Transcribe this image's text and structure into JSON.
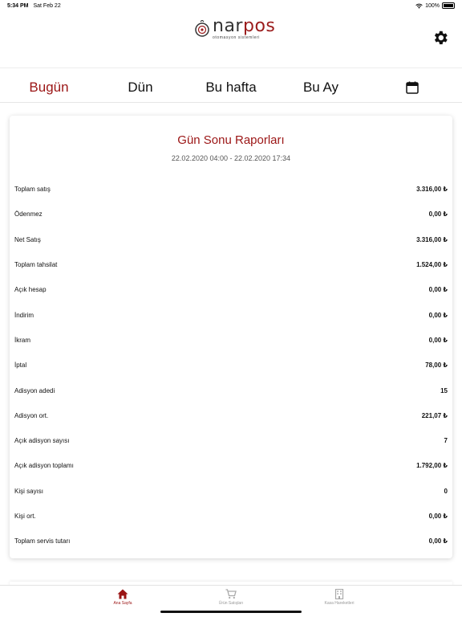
{
  "status_bar": {
    "time": "5:34 PM",
    "date": "Sat Feb 22",
    "battery": "100%"
  },
  "header": {
    "logo_brand_left": "nar",
    "logo_brand_right": "pos",
    "logo_tagline": "otomasyon sistemleri",
    "settings_icon": "gear-icon"
  },
  "tabs": [
    {
      "label": "Bugün",
      "active": true
    },
    {
      "label": "Dün",
      "active": false
    },
    {
      "label": "Bu hafta",
      "active": false
    },
    {
      "label": "Bu Ay",
      "active": false
    }
  ],
  "calendar_icon": "calendar-icon",
  "report": {
    "title": "Gün Sonu Raporları",
    "date_range": "22.02.2020 04:00 - 22.02.2020 17:34",
    "rows": [
      {
        "label": "Toplam satış",
        "value": "3.316,00 ₺"
      },
      {
        "label": "Ödenmez",
        "value": "0,00 ₺"
      },
      {
        "label": "Net Satış",
        "value": "3.316,00 ₺"
      },
      {
        "label": "Toplam tahsilat",
        "value": "1.524,00 ₺"
      },
      {
        "label": "Açık hesap",
        "value": "0,00 ₺"
      },
      {
        "label": "İndirim",
        "value": "0,00 ₺"
      },
      {
        "label": "İkram",
        "value": "0,00 ₺"
      },
      {
        "label": "İptal",
        "value": "78,00 ₺"
      },
      {
        "label": "Adisyon adedi",
        "value": "15"
      },
      {
        "label": "Adisyon ort.",
        "value": "221,07 ₺"
      },
      {
        "label": "Açık adisyon sayısı",
        "value": "7"
      },
      {
        "label": "Açık adisyon toplamı",
        "value": "1.792,00 ₺"
      },
      {
        "label": "Kişi sayısı",
        "value": "0"
      },
      {
        "label": "Kişi ort.",
        "value": "0,00 ₺"
      },
      {
        "label": "Toplam servis tutarı",
        "value": "0,00 ₺"
      }
    ]
  },
  "bottom_nav": [
    {
      "label": "Ana Sayfa",
      "icon": "home-icon",
      "active": true
    },
    {
      "label": "Ürün Satışları",
      "icon": "cart-icon",
      "active": false
    },
    {
      "label": "Kasa Hareketleri",
      "icon": "building-icon",
      "active": false
    }
  ],
  "colors": {
    "accent": "#9b1515",
    "inactive": "#999999"
  }
}
